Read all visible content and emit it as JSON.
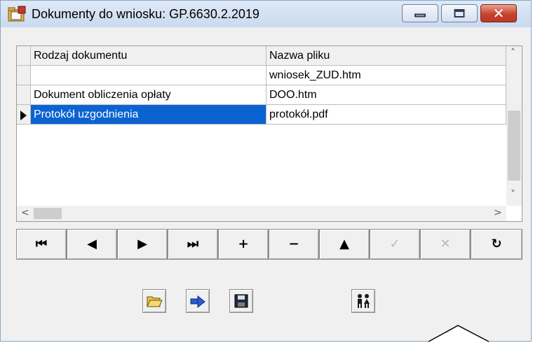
{
  "window": {
    "title": "Dokumenty do wniosku: GP.6630.2.2019",
    "controls": [
      "minimize-icon",
      "maximize-icon",
      "close-icon"
    ],
    "close_glyph": "✕"
  },
  "grid": {
    "columns": [
      "Rodzaj dokumentu",
      "Nazwa pliku"
    ],
    "rows": [
      {
        "type": "",
        "file": "wniosek_ZUD.htm"
      },
      {
        "type": "Dokument obliczenia opłaty",
        "file": "DOO.htm"
      },
      {
        "type": "Protokół uzgodnienia",
        "file": "protokół.pdf"
      }
    ],
    "selected_row_index": 2,
    "selection_color": "#0b63d2"
  },
  "scrollbars": {
    "up": "˄",
    "down": "˅",
    "left": "<",
    "right": ">"
  },
  "navigator": {
    "buttons": [
      {
        "name": "first-record",
        "icon": "first-icon",
        "glyph": "⏮",
        "enabled": true
      },
      {
        "name": "prior-record",
        "icon": "prior-icon",
        "glyph": "◀",
        "enabled": true
      },
      {
        "name": "next-record",
        "icon": "next-icon",
        "glyph": "▶",
        "enabled": true
      },
      {
        "name": "last-record",
        "icon": "last-icon",
        "glyph": "⏭",
        "enabled": true
      },
      {
        "name": "insert-record",
        "icon": "plus-icon",
        "glyph": "+",
        "enabled": true
      },
      {
        "name": "delete-record",
        "icon": "minus-icon",
        "glyph": "−",
        "enabled": true
      },
      {
        "name": "edit-record",
        "icon": "triangle-up-icon",
        "glyph": "▲",
        "enabled": true
      },
      {
        "name": "post-record",
        "icon": "check-icon",
        "glyph": "✓",
        "enabled": false
      },
      {
        "name": "cancel-edit",
        "icon": "cancel-icon",
        "glyph": "✕",
        "enabled": false
      },
      {
        "name": "refresh-data",
        "icon": "refresh-icon",
        "glyph": "↻",
        "enabled": true
      }
    ]
  },
  "toolbar": {
    "buttons": [
      {
        "name": "open-folder",
        "icon": "open-folder-icon"
      },
      {
        "name": "send-forward",
        "icon": "arrow-right-icon"
      },
      {
        "name": "save",
        "icon": "save-icon"
      },
      {
        "name": "users",
        "icon": "people-icon"
      }
    ]
  }
}
